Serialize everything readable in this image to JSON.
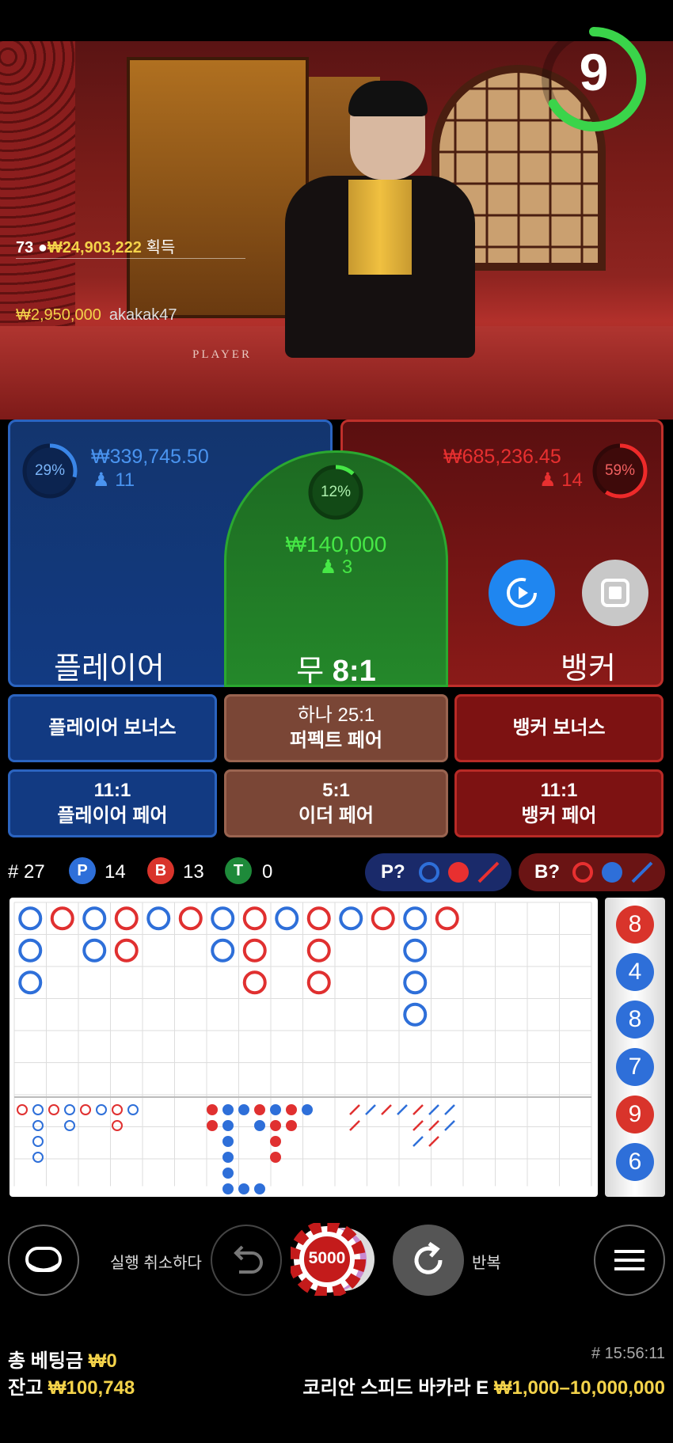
{
  "timer": {
    "seconds": "9"
  },
  "winners": {
    "count": "73",
    "total": "₩24,903,222",
    "total_suffix": "획득",
    "top_amount": "₩2,950,000",
    "top_user": "akakak47"
  },
  "video": {
    "table_print": "PLAYER"
  },
  "player": {
    "percent": "29%",
    "amount": "₩339,745.50",
    "bettors": "11",
    "label": "플레이어",
    "color": "#3a86e8"
  },
  "tie": {
    "percent": "12%",
    "amount": "₩140,000",
    "bettors": "3",
    "label": "무",
    "payout": "8:1",
    "color": "#3ee63e"
  },
  "banker": {
    "percent": "59%",
    "amount": "₩685,236.45",
    "bettors": "14",
    "label": "뱅커",
    "color": "#e8282a"
  },
  "side_bets": {
    "player_bonus": "플레이어 보너스",
    "perfect_pair_line1": "하나 25:1",
    "perfect_pair_line2": "퍼펙트 페어",
    "banker_bonus": "뱅커 보너스",
    "player_pair_line1": "11:1",
    "player_pair_line2": "플레이어 페어",
    "either_pair_line1": "5:1",
    "either_pair_line2": "이더 페어",
    "banker_pair_line1": "11:1",
    "banker_pair_line2": "뱅커 페어"
  },
  "stats": {
    "round": "# 27",
    "p_letter": "P",
    "p_count": "14",
    "b_letter": "B",
    "b_count": "13",
    "t_letter": "T",
    "t_count": "0",
    "player_ask": "P?",
    "banker_ask": "B?"
  },
  "bead_road": [
    {
      "value": "8",
      "color": "#d9342b"
    },
    {
      "value": "4",
      "color": "#2e6fd9"
    },
    {
      "value": "8",
      "color": "#2e6fd9"
    },
    {
      "value": "7",
      "color": "#2e6fd9"
    },
    {
      "value": "9",
      "color": "#d9342b"
    },
    {
      "value": "6",
      "color": "#2e6fd9"
    }
  ],
  "controls": {
    "undo_label": "실행 취소하다",
    "chip_value": "5000",
    "repeat_label": "반복"
  },
  "footer": {
    "total_bet_label": "총 베팅금",
    "total_bet_value": "₩0",
    "balance_label": "잔고",
    "balance_value": "₩100,748",
    "game_id": "# 15:56:11",
    "table_name": "코리안 스피드 바카라 E",
    "limits": "₩1,000–10,000,000"
  }
}
